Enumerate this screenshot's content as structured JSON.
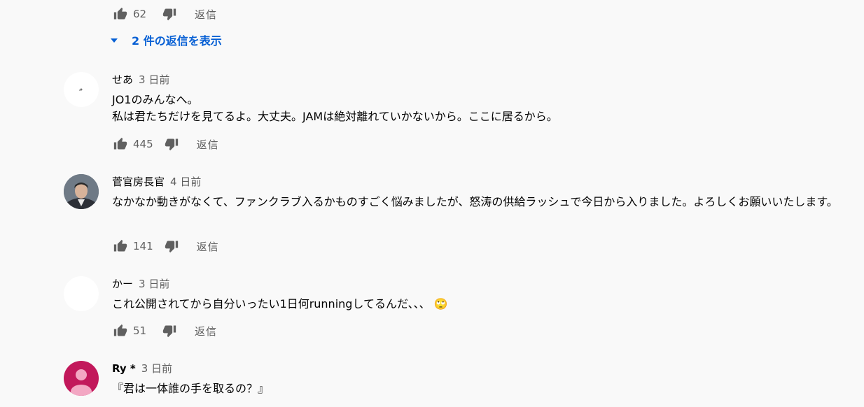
{
  "top_actions": {
    "likes": "62",
    "reply_label": "返信"
  },
  "show_replies": {
    "label": "2 件の返信を表示"
  },
  "comments": [
    {
      "author": "せあ",
      "time": "3 日前",
      "text": "JO1のみんなへ。\n私は君たちだけを見てるよ。大丈夫。JAMは絶対離れていかないから。ここに居るから。",
      "likes": "445",
      "reply_label": "返信"
    },
    {
      "author": "菅官房長官",
      "time": "4 日前",
      "text": "なかなか動きがなくて、ファンクラブ入るかものすごく悩みましたが、怒涛の供給ラッシュで今日から入りました。よろしくお願いいたします。",
      "likes": "141",
      "reply_label": "返信"
    },
    {
      "author": "かー",
      "time": "3 日前",
      "text": "これ公開されてから自分いったい1日何runningしてるんだ、、、",
      "emoji": "🙄",
      "likes": "51",
      "reply_label": "返信"
    },
    {
      "author": "Ry *",
      "time": "3 日前",
      "text": "『君は一体誰の手を取るの？』"
    }
  ],
  "colors": {
    "link": "#065fd4",
    "secondary": "#606060",
    "avatar_pink": "#c2185b"
  }
}
